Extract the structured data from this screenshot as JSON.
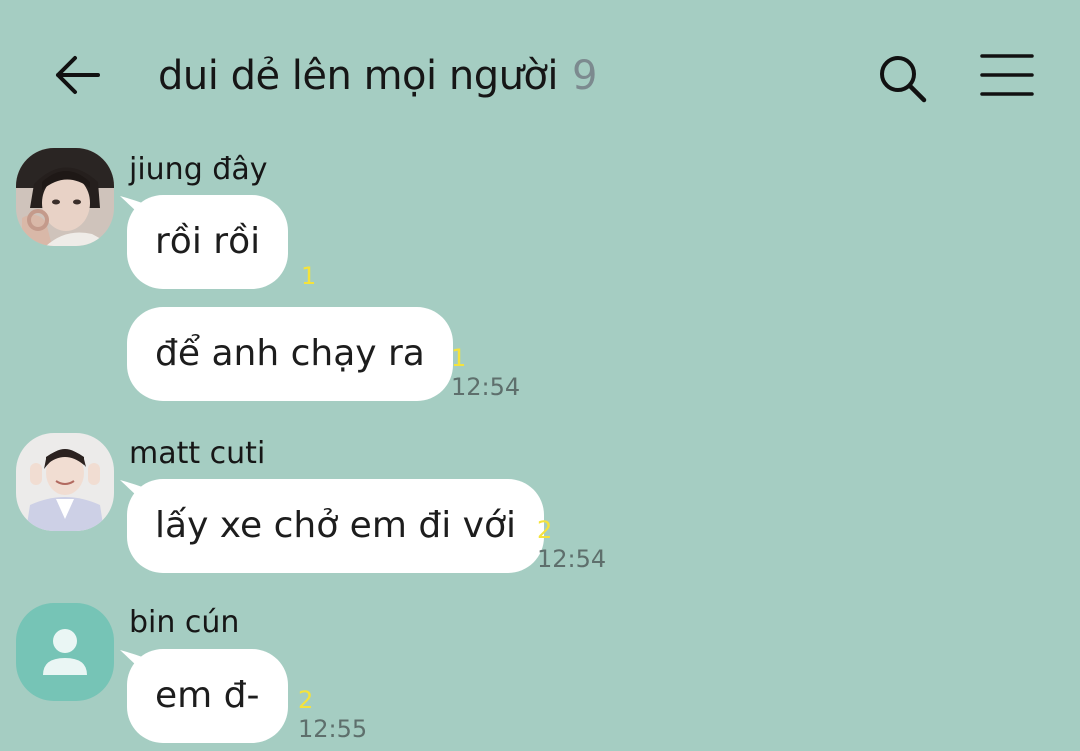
{
  "header": {
    "title": "dui dẻ lên mọi người",
    "member_count": "9"
  },
  "messages": [
    {
      "sender": "jiung đây",
      "texts": [
        {
          "text": "rồi rồi",
          "unread": "1",
          "time": ""
        },
        {
          "text": "để anh chạy ra",
          "unread": "1",
          "time": "12:54"
        }
      ]
    },
    {
      "sender": "matt cuti",
      "texts": [
        {
          "text": "lấy xe chở em đi với",
          "unread": "2",
          "time": "12:54"
        }
      ]
    },
    {
      "sender": "bin cún",
      "texts": [
        {
          "text": "em đ-",
          "unread": "2",
          "time": "12:55"
        }
      ]
    }
  ],
  "colors": {
    "background": "#a5cdc2",
    "bubble": "#ffffff",
    "unread": "#f5e33b",
    "timestamp": "#5e6f6c",
    "default_avatar": "#76c4b6"
  },
  "icons": {
    "back": "arrow-left-icon",
    "search": "search-icon",
    "menu": "hamburger-menu-icon",
    "default_avatar": "person-silhouette-icon"
  }
}
